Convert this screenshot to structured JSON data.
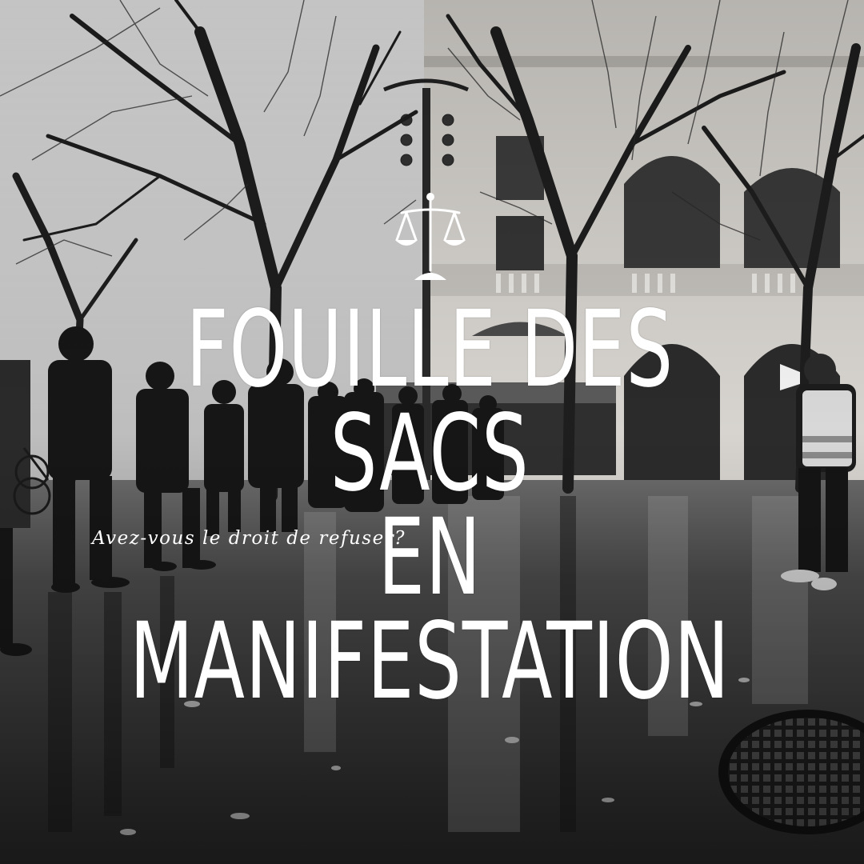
{
  "post": {
    "title_line_1": "FOUILLE DES SACS",
    "title_line_2": "EN MANIFESTATION",
    "subtitle": "Avez-vous le droit de refuser?"
  },
  "icons": {
    "emblem": "scales-of-justice-icon"
  },
  "colors": {
    "text": "#ffffff",
    "sky": "#cfcfcf",
    "pavement": "#3a3a3a"
  }
}
